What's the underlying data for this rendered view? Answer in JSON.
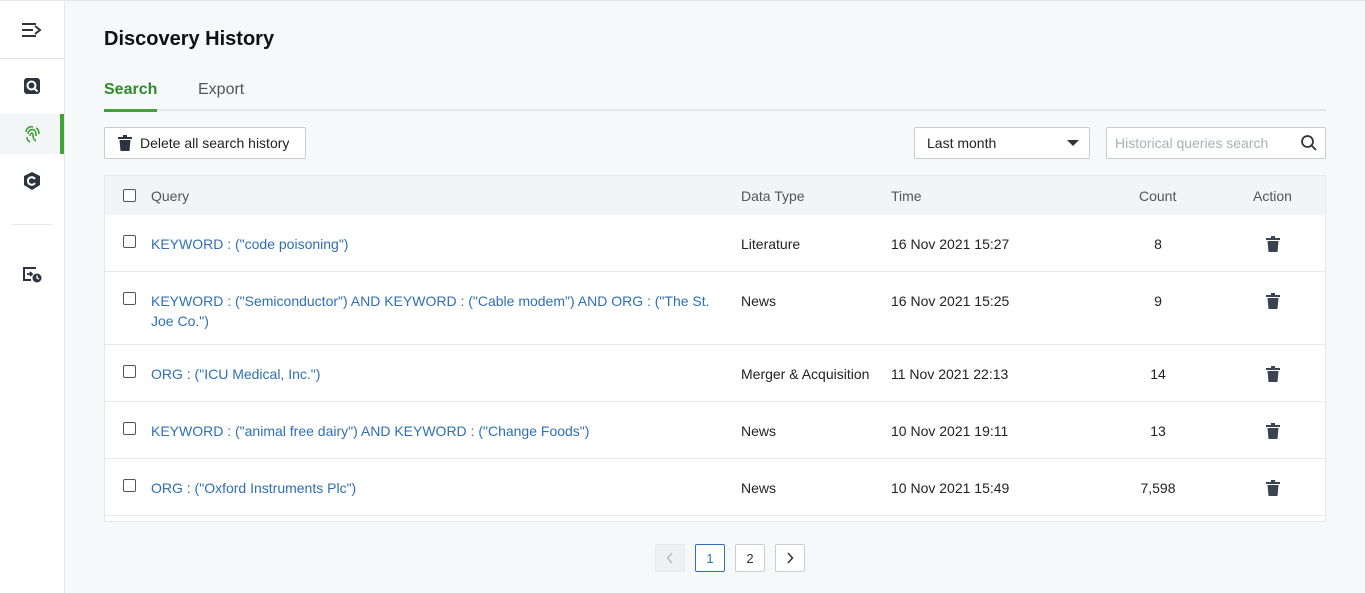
{
  "sidebar": {
    "items": [
      {
        "icon": "menu-collapse-icon"
      },
      {
        "icon": "search-document-icon"
      },
      {
        "icon": "fingerprint-icon",
        "active": true
      },
      {
        "icon": "shield-icon"
      },
      {
        "icon": "history-log-icon"
      }
    ]
  },
  "page": {
    "title": "Discovery History",
    "tabs": [
      {
        "label": "Search",
        "active": true
      },
      {
        "label": "Export",
        "active": false
      }
    ]
  },
  "toolbar": {
    "delete_all_label": "Delete all search history",
    "period_select_value": "Last month",
    "search_placeholder": "Historical queries search"
  },
  "table": {
    "headers": {
      "query": "Query",
      "data_type": "Data Type",
      "time": "Time",
      "count": "Count",
      "action": "Action"
    },
    "rows": [
      {
        "query": "KEYWORD : (\"code poisoning\")",
        "data_type": "Literature",
        "time": "16 Nov 2021 15:27",
        "count": "8"
      },
      {
        "query": "KEYWORD : (\"Semiconductor\") AND KEYWORD : (\"Cable modem\") AND ORG : (\"The St. Joe Co.\")",
        "data_type": "News",
        "time": "16 Nov 2021 15:25",
        "count": "9"
      },
      {
        "query": "ORG : (\"ICU Medical, Inc.\")",
        "data_type": "Merger & Acquisition",
        "time": "11 Nov 2021 22:13",
        "count": "14"
      },
      {
        "query": "KEYWORD : (\"animal free dairy\") AND KEYWORD : (\"Change Foods\")",
        "data_type": "News",
        "time": "10 Nov 2021 19:11",
        "count": "13"
      },
      {
        "query": "ORG : (\"Oxford Instruments Plc\")",
        "data_type": "News",
        "time": "10 Nov 2021 15:49",
        "count": "7,598"
      }
    ]
  },
  "pagination": {
    "pages": [
      "1",
      "2"
    ],
    "current": "1"
  },
  "colors": {
    "accent_green": "#3fa336",
    "link_blue": "#2f6fb5"
  }
}
